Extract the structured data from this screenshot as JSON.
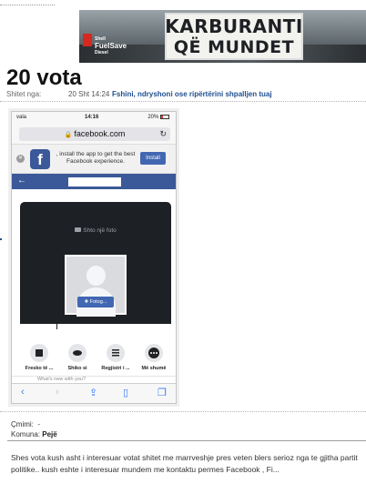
{
  "banner": {
    "brand_top": "Shell",
    "brand_main": "FuelSave",
    "brand_sub": "Diesel",
    "line1": "KARBURANTI",
    "line2": "QË MUNDET"
  },
  "listing": {
    "title": "20 vota",
    "shared_label": "Shitet nga:",
    "date": "20 Sht 14:24",
    "edit_link": "Fshini, ndryshoni ose ripërtërini shpalljen tuaj"
  },
  "phone": {
    "carrier": "vala",
    "time": "14:16",
    "battery": "20%",
    "url": "facebook.com",
    "app_banner_text": ", install the app to get the best Facebook experience.",
    "install_label": "Install",
    "add_photo": "Shto një foto",
    "upload_label": "Fotog...",
    "actions": [
      {
        "label": "Fresko të ...",
        "icon": "edit-profile-icon"
      },
      {
        "label": "Shiko si",
        "icon": "eye-icon"
      },
      {
        "label": "Regjistri i ...",
        "icon": "list-icon"
      },
      {
        "label": "Më shumë",
        "icon": "more-icon"
      }
    ],
    "composer_text": "What's new with you?"
  },
  "info": {
    "price_label": "Çmimi:",
    "price_value": "-",
    "municipality_label": "Komuna:",
    "municipality_value": "Pejë"
  },
  "description": "Shes vota kush asht i interesuar votat shitet me marrveshje pres veten blers serioz nga te gjitha partit politike.. kush eshte i interesuar mundem me kontaktu permes Facebook , Fi..."
}
